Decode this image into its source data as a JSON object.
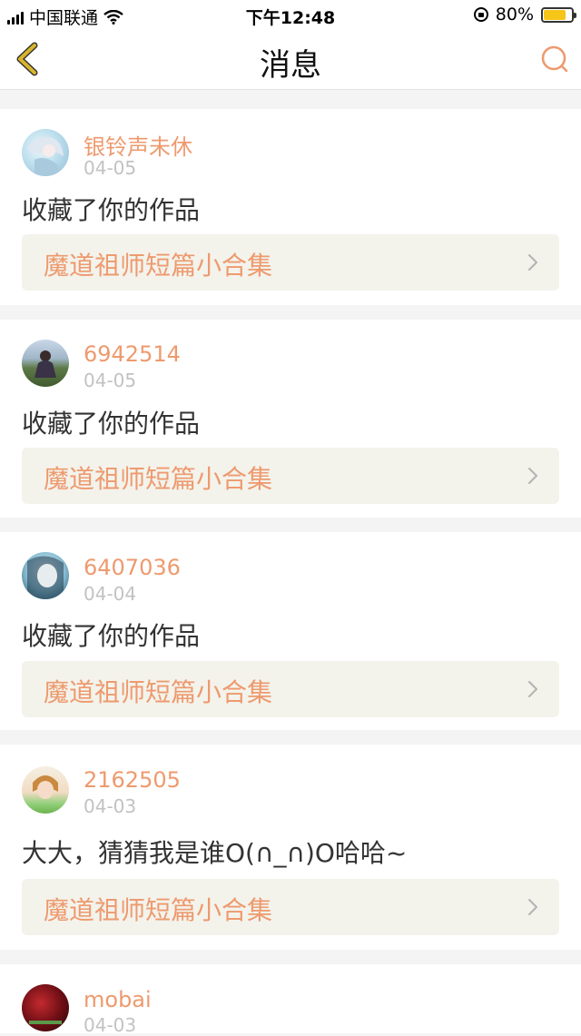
{
  "status_bar": {
    "carrier": "中国联通",
    "time": "下午12:48",
    "battery": "80%",
    "battery_level": 0.8
  },
  "nav": {
    "title": "消息",
    "back_icon": "chevron-left-icon",
    "search_icon": "search-icon"
  },
  "messages": [
    {
      "username": "银铃声未休",
      "date": "04-05",
      "text": "收藏了你的作品",
      "work_title": "魔道祖师短篇小合集"
    },
    {
      "username": "6942514",
      "date": "04-05",
      "text": "收藏了你的作品",
      "work_title": "魔道祖师短篇小合集"
    },
    {
      "username": "6407036",
      "date": "04-04",
      "text": "收藏了你的作品",
      "work_title": "魔道祖师短篇小合集"
    },
    {
      "username": "2162505",
      "date": "04-03",
      "text": "大大，猜猜我是谁O(∩_∩)O哈哈~",
      "work_title": "魔道祖师短篇小合集"
    },
    {
      "username": "mobai",
      "date": "04-03"
    }
  ],
  "colors": {
    "accent": "#ee9a6e",
    "back_icon": "#d8b52c",
    "work_bg": "#f3f3ec",
    "page_bg": "#f4f4f4"
  }
}
